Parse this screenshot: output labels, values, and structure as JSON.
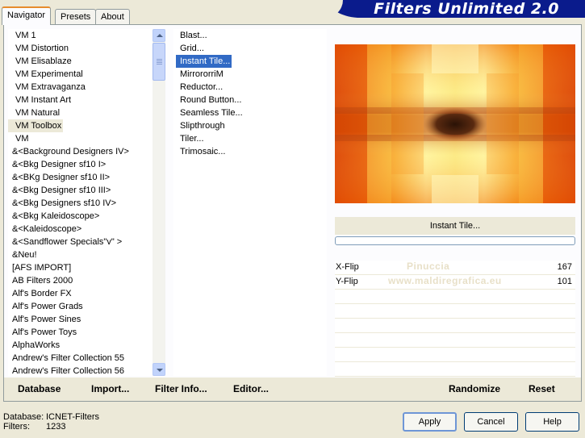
{
  "header": {
    "tabs": [
      "Navigator",
      "Presets",
      "About"
    ],
    "active_tab": "Navigator",
    "brand_title": "Filters Unlimited 2.0"
  },
  "categories": {
    "items": [
      "VM 1",
      "VM Distortion",
      "VM Elisablaze",
      "VM Experimental",
      "VM Extravaganza",
      "VM Instant Art",
      "VM Natural",
      "VM Toolbox",
      "VM",
      "&<Background Designers IV>",
      "&<Bkg Designer sf10 I>",
      "&<BKg Designer sf10 II>",
      "&<Bkg Designer sf10 III>",
      "&<Bkg Designers sf10 IV>",
      "&<Bkg Kaleidoscope>",
      "&<Kaleidoscope>",
      "&<Sandflower Specials\"v\" >",
      "&Neu!",
      "[AFS IMPORT]",
      "AB Filters 2000",
      "Alf's Border FX",
      "Alf's Power Grads",
      "Alf's Power Sines",
      "Alf's Power Toys",
      "AlphaWorks",
      "Andrew's Filter Collection 55",
      "Andrew's Filter Collection 56"
    ],
    "selected": "VM Toolbox"
  },
  "filters": {
    "items": [
      "Blast...",
      "Grid...",
      "Instant Tile...",
      "MirrororriM",
      "Reductor...",
      "Round Button...",
      "Seamless Tile...",
      "Slipthrough",
      "Tiler...",
      "Trimosaic..."
    ],
    "selected": "Instant Tile..."
  },
  "preview": {
    "filter_name": "Instant Tile...",
    "colors": {
      "orange": "#f07010",
      "red": "#d43000",
      "yellow": "#f8e070",
      "dark": "#3a1a08",
      "pale": "#fff4a0"
    }
  },
  "params": [
    {
      "label": "X-Flip",
      "value": "167"
    },
    {
      "label": "Y-Flip",
      "value": "101"
    }
  ],
  "watermark": {
    "line1": "Pinuccia",
    "line2": "www.maldiregrafica.eu"
  },
  "main_actions": {
    "database": "Database",
    "import": "Import...",
    "filter_info": "Filter Info...",
    "editor": "Editor...",
    "randomize": "Randomize",
    "reset": "Reset"
  },
  "status": {
    "database_label": "Database:",
    "database_value": "ICNET-Filters",
    "filters_label": "Filters:",
    "filters_value": "1233"
  },
  "dialog": {
    "apply": "Apply",
    "cancel": "Cancel",
    "help": "Help"
  }
}
